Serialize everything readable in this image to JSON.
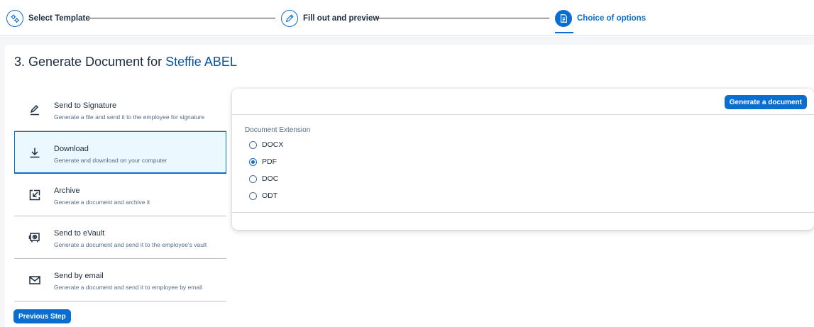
{
  "stepper": {
    "steps": [
      {
        "label": "Select Template",
        "icon": "gears-icon"
      },
      {
        "label": "Fill out and preview",
        "icon": "edit-icon"
      },
      {
        "label": "Choice of options",
        "icon": "document-icon",
        "active": true
      }
    ]
  },
  "page": {
    "title_prefix": "3. Generate Document for ",
    "employee_name": "Steffie ABEL"
  },
  "options": [
    {
      "title": "Send to Signature",
      "desc": "Generate a file and send it to the employee for signature",
      "icon": "signature-pen-icon"
    },
    {
      "title": "Download",
      "desc": "Generate and download on your computer",
      "icon": "download-icon",
      "selected": true
    },
    {
      "title": "Archive",
      "desc": "Generate a document and archive it",
      "icon": "archive-icon"
    },
    {
      "title": "Send to eVault",
      "desc": "Generate a document and send it to the employee's vault",
      "icon": "vault-icon"
    },
    {
      "title": "Send by email",
      "desc": "Generate a document and send it to employee by email",
      "icon": "envelope-icon"
    }
  ],
  "buttons": {
    "previous": "Previous Step",
    "generate": "Generate a document"
  },
  "extension": {
    "label": "Document Extension",
    "options": [
      "DOCX",
      "PDF",
      "DOC",
      "ODT"
    ],
    "selected": "PDF"
  },
  "colors": {
    "accent": "#0a6ed1",
    "selected_bg": "#ebf8ff",
    "name_color": "#0854a0"
  }
}
